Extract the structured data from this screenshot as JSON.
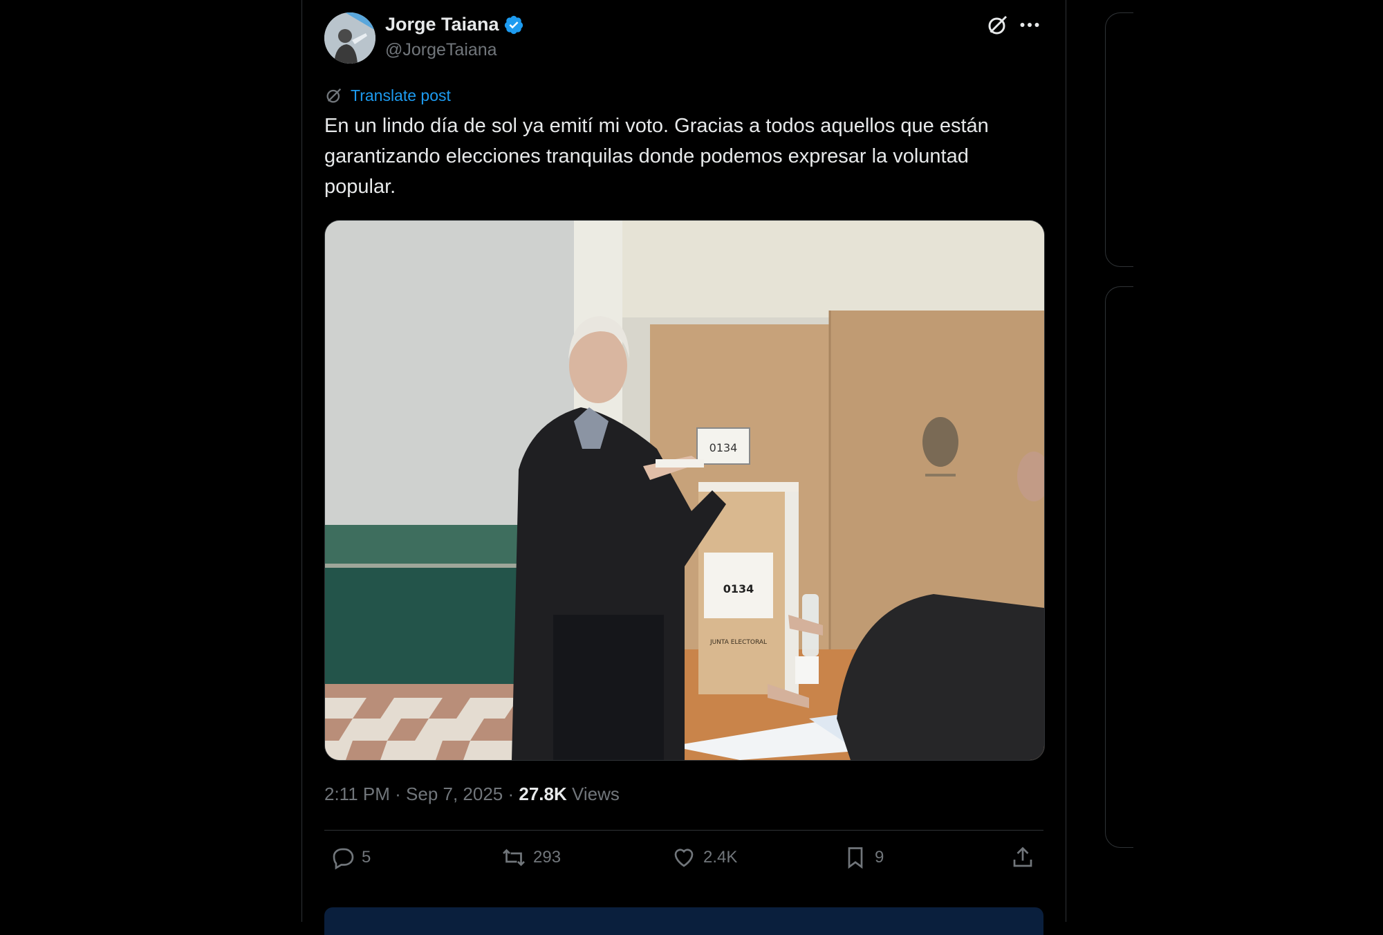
{
  "author": {
    "name": "Jorge Taiana",
    "handle": "@JorgeTaiana"
  },
  "translate_label": "Translate post",
  "text": "En un lindo día de sol ya emití mi voto. Gracias a todos aquellos que están garantizando elecciones tranquilas donde podemos expresar la voluntad popular.",
  "media": {
    "box_label": "0134",
    "box_sign": "JUNTA ELECTORAL"
  },
  "meta": {
    "time": "2:11 PM",
    "separator": " · ",
    "date": "Sep 7, 2025",
    "views_count": "27.8K",
    "views_label": "Views"
  },
  "actions": {
    "replies": "5",
    "reposts": "293",
    "likes": "2.4K",
    "bookmarks": "9"
  },
  "colors": {
    "accent": "#1d9bf0",
    "background": "#000000",
    "text": "#e7e9ea",
    "muted": "#71767b"
  }
}
